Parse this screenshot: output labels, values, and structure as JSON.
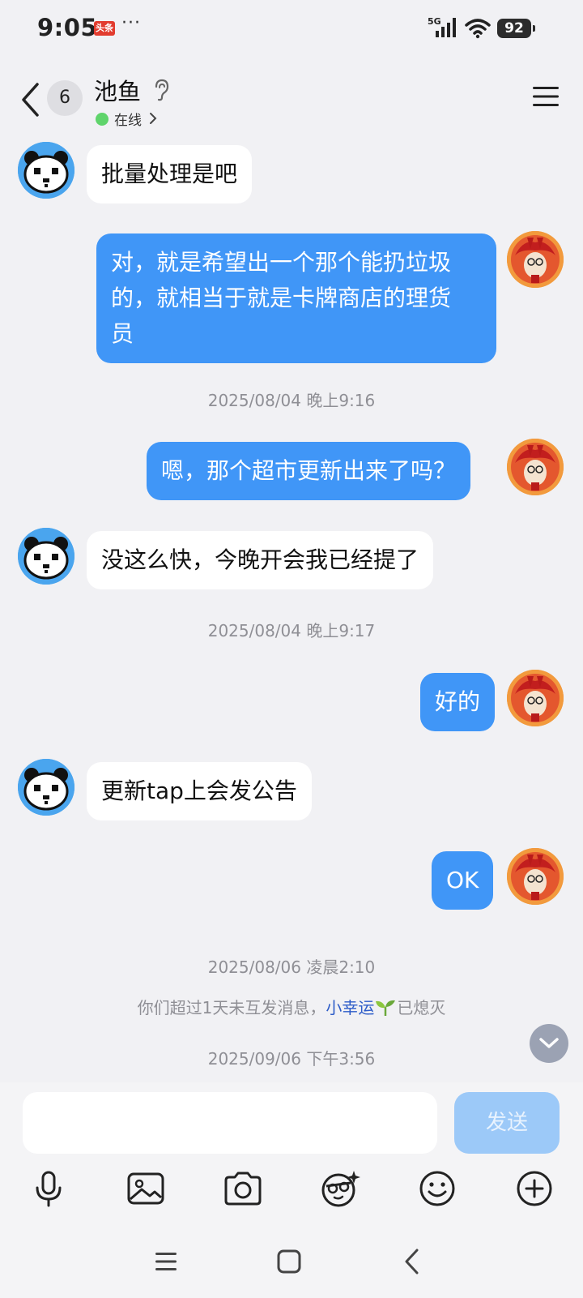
{
  "status_bar": {
    "time": "9:05",
    "news_badge": "头条",
    "more": "···",
    "network": "5G",
    "battery": "92"
  },
  "header": {
    "unread_count": "6",
    "contact_name": "池鱼",
    "status": "在线"
  },
  "messages": [
    {
      "side": "in",
      "avatar": "bear",
      "text": "批量处理是吧"
    },
    {
      "side": "out",
      "avatar": "pony",
      "lines": [
        "对，就是希望出一个那个能扔垃圾",
        "的，就相当于就是卡牌商店的理货",
        "员"
      ]
    },
    {
      "timestamp": "2025/08/04 晚上9:16"
    },
    {
      "side": "out",
      "avatar": "pony",
      "text": "嗯，那个超市更新出来了吗？"
    },
    {
      "side": "in",
      "avatar": "bear",
      "text": "没这么快，今晚开会我已经提了"
    },
    {
      "timestamp": "2025/08/04 晚上9:17"
    },
    {
      "side": "out",
      "avatar": "pony",
      "text": "好的"
    },
    {
      "side": "in",
      "avatar": "bear",
      "text": "更新tap上会发公告"
    },
    {
      "side": "out",
      "avatar": "pony",
      "text": "OK"
    },
    {
      "timestamp": "2025/08/06 凌晨2:10"
    },
    {
      "timestamp": "2025/09/06 下午3:56"
    }
  ],
  "notice": {
    "prefix": "你们超过1天未互发消息，",
    "link": "小幸运",
    "suffix": "已熄灭"
  },
  "composer": {
    "input_value": "",
    "send_label": "发送"
  },
  "toolbar_icons": [
    "microphone-icon",
    "image-icon",
    "camera-icon",
    "sticker-icon",
    "emoji-icon",
    "plus-icon"
  ],
  "colors": {
    "outgoing_bubble": "#4096f7",
    "incoming_bubble": "#ffffff",
    "background": "#f1f1f4",
    "online": "#5fd46b",
    "send_disabled": "#9cc9f8"
  }
}
